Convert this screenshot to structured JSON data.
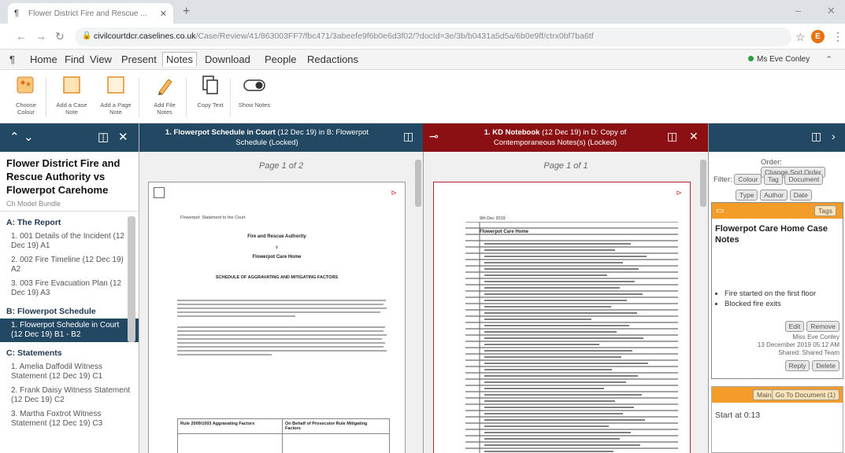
{
  "browser": {
    "tab_title": "Flower District Fire and Rescue ...",
    "url_host": "civilcourtdcr.caselines.co.uk",
    "url_path": "/Case/Review/41/863003FF7/fbc471/3abeefe9f6b0e6d3f02/?docId=3e/3b/b0431a5d5a/6b0e9ff/ctrx0bf7ba6tf",
    "icons": [
      "back-icon",
      "forward-icon",
      "reload-icon",
      "lock-icon",
      "star-icon",
      "more-icon"
    ]
  },
  "menu": {
    "items": [
      "Home",
      "Find",
      "View",
      "Present",
      "Notes",
      "Download",
      "People",
      "Redactions"
    ],
    "active": "Notes",
    "user": "Ms Eve Conley"
  },
  "ribbon": {
    "buttons": [
      {
        "label": "Choose Colour",
        "icon": "palette-icon"
      },
      {
        "label": "Add a Case Note",
        "icon": "case-note-icon"
      },
      {
        "label": "Add a Page Note",
        "icon": "page-note-icon"
      },
      {
        "label": "Add File Notes",
        "icon": "pencil-icon"
      },
      {
        "label": "Copy Text",
        "icon": "copy-icon"
      },
      {
        "label": "Show Notes",
        "icon": "toggle-icon"
      }
    ]
  },
  "left_panel": {
    "title": "Flower District Fire and Rescue Authority vs Flowerpot Carehome",
    "subtitle": "Ch Model Bundle",
    "sections": [
      {
        "label": "A:  The Report",
        "items": [
          {
            "label": "1. 001 Details of the Incident (12 Dec 19) A1",
            "selected": false
          },
          {
            "label": "2. 002 Fire Timeline (12 Dec 19) A2",
            "selected": false
          },
          {
            "label": "3. 003 Fire Evacuation Plan (12 Dec 19) A3",
            "selected": false
          }
        ]
      },
      {
        "label": "B:  Flowerpot Schedule",
        "items": [
          {
            "label": "1. Flowerpot Schedule in Court (12 Dec 19) B1 - B2",
            "selected": true
          }
        ]
      },
      {
        "label": "C:  Statements",
        "items": [
          {
            "label": "1. Amelia Daffodil Witness Statement (12 Dec 19) C1",
            "selected": false
          },
          {
            "label": "2. Frank Daisy Witness Statement (12 Dec 19) C2",
            "selected": false
          },
          {
            "label": "3. Martha Foxtrot Witness Statement (12 Dec 19) C3",
            "selected": false
          }
        ]
      }
    ]
  },
  "doc1": {
    "title_bold": "1. Flowerpot Schedule in Court",
    "title_rest": " (12 Dec 19) in B: Flowerpot Schedule",
    "status": "(Locked)",
    "page_label": "Page 1 of 2",
    "page": {
      "line1": "Flowerpot: Statement to the Court",
      "line2": "Fire and Rescue Authority",
      "line3": "v",
      "line4": "Flowerpot Care Home",
      "heading": "SCHEDULE OF AGGRAVATING AND MITIGATING FACTORS",
      "table_col1": "Rule 2009/1003 Aggravating Factors",
      "table_col2": "On Behalf of Prosecutor Rule Mitigating Factors"
    }
  },
  "doc2": {
    "title_bold": "1. KD Notebook",
    "title_rest": " (12 Dec 19) in D: Copy of Contemporaneous Notes(s)",
    "status": "(Locked)",
    "page_label": "Page 1 of 1",
    "page": {
      "date": "9th Dec 2019",
      "heading": "Flowerpot Care Home"
    }
  },
  "right_panel": {
    "order_label": "Order:",
    "order_button": "Change Sort Order",
    "filter_label": "Filter:",
    "filters": [
      "Colour",
      "Tag",
      "Document",
      "Type",
      "Author",
      "Date"
    ],
    "note1": {
      "badge": "Tags",
      "title": "Flowerpot Care Home Case Notes",
      "bullets": [
        "Fire started on the first floor",
        "Blocked fire exits"
      ],
      "edit": "Edit",
      "remove": "Remove",
      "author": "Miss Eve Conley",
      "date": "13 December 2019 05:12 AM",
      "shared": "Shared: Shared Team",
      "reply": "Reply",
      "delete": "Delete"
    },
    "note2": {
      "badge": "Main",
      "link": "Go To Document (1)",
      "text": "Start at 0:13"
    }
  }
}
